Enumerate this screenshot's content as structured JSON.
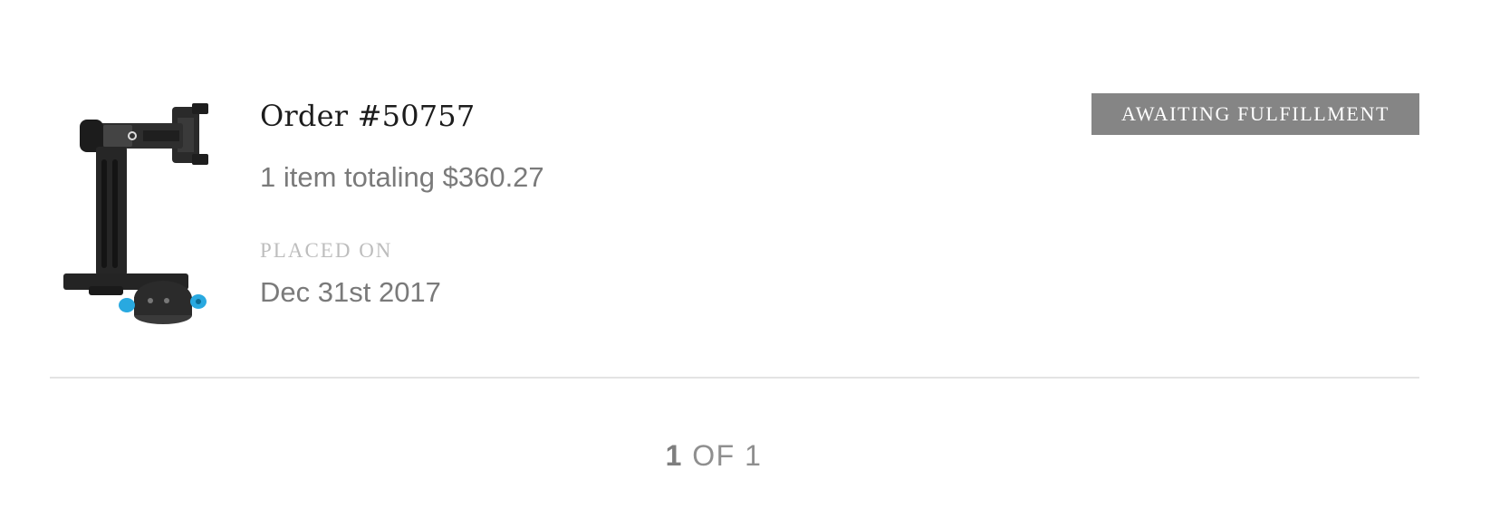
{
  "order": {
    "title": "Order #50757",
    "summary": "1 item totaling $360.27",
    "placed_label": "PLACED ON",
    "placed_date": "Dec 31st 2017",
    "status": "AWAITING FULFILLMENT",
    "status_color": "#858585",
    "product_image_icon": "panoramic-tripod-head-product-image"
  },
  "pagination": {
    "current": "1",
    "of_label": "OF",
    "total": "1"
  }
}
